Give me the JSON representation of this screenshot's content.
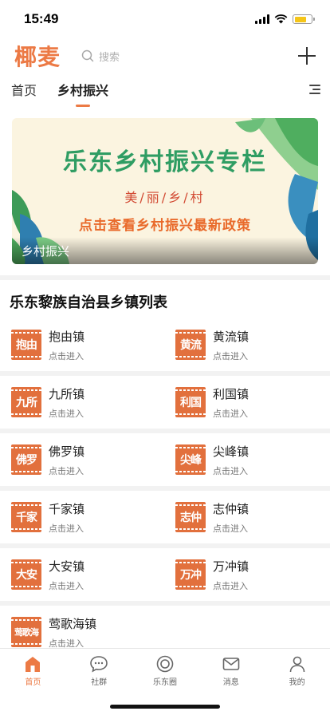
{
  "status_bar": {
    "time": "15:49"
  },
  "header": {
    "logo": "椰麦",
    "search_placeholder": "搜索"
  },
  "tabs": [
    {
      "label": "首页",
      "active": false
    },
    {
      "label": "乡村振兴",
      "active": true
    }
  ],
  "banner": {
    "title": "乐东乡村振兴专栏",
    "subtitle": "美/丽/乡/村",
    "cta": "点击查看乡村振兴最新政策",
    "caption": "乡村振兴"
  },
  "section": {
    "title": "乐东黎族自治县乡镇列表"
  },
  "towns": [
    {
      "name": "抱由镇",
      "logo": "抱由",
      "hint": "点击进入"
    },
    {
      "name": "黄流镇",
      "logo": "黄流",
      "hint": "点击进入"
    },
    {
      "name": "九所镇",
      "logo": "九所",
      "hint": "点击进入"
    },
    {
      "name": "利国镇",
      "logo": "利国",
      "hint": "点击进入"
    },
    {
      "name": "佛罗镇",
      "logo": "佛罗",
      "hint": "点击进入"
    },
    {
      "name": "尖峰镇",
      "logo": "尖峰",
      "hint": "点击进入"
    },
    {
      "name": "千家镇",
      "logo": "千家",
      "hint": "点击进入"
    },
    {
      "name": "志仲镇",
      "logo": "志仲",
      "hint": "点击进入"
    },
    {
      "name": "大安镇",
      "logo": "大安",
      "hint": "点击进入"
    },
    {
      "name": "万冲镇",
      "logo": "万冲",
      "hint": "点击进入"
    },
    {
      "name": "莺歌海镇",
      "logo": "莺歌海",
      "hint": "点击进入"
    }
  ],
  "bottom_nav": [
    {
      "label": "首页",
      "icon": "home-icon",
      "active": true
    },
    {
      "label": "社群",
      "icon": "chat-icon",
      "active": false
    },
    {
      "label": "乐东圈",
      "icon": "circle-icon",
      "active": false
    },
    {
      "label": "消息",
      "icon": "mail-icon",
      "active": false
    },
    {
      "label": "我的",
      "icon": "user-icon",
      "active": false
    }
  ],
  "colors": {
    "accent": "#ec7a45",
    "banner_green": "#2f9d63",
    "town_logo": "#e2703d"
  }
}
